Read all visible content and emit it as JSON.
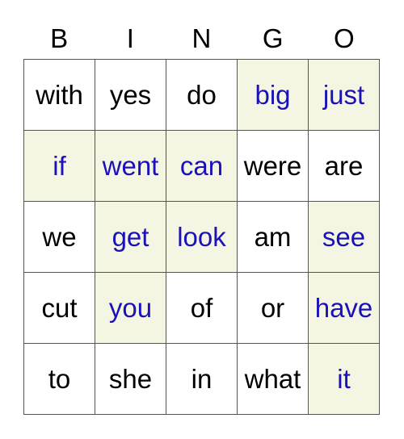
{
  "title_letters": [
    "B",
    "I",
    "N",
    "G",
    "O"
  ],
  "colors": {
    "marked_background": "#f5f5e3",
    "marked_text": "#1a12b8",
    "unmarked_text": "#000000",
    "grid_line": "#555555"
  },
  "rows": [
    [
      {
        "word": "with",
        "marked": false
      },
      {
        "word": "yes",
        "marked": false
      },
      {
        "word": "do",
        "marked": false
      },
      {
        "word": "big",
        "marked": true
      },
      {
        "word": "just",
        "marked": true
      }
    ],
    [
      {
        "word": "if",
        "marked": true
      },
      {
        "word": "went",
        "marked": true
      },
      {
        "word": "can",
        "marked": true
      },
      {
        "word": "were",
        "marked": false
      },
      {
        "word": "are",
        "marked": false
      }
    ],
    [
      {
        "word": "we",
        "marked": false
      },
      {
        "word": "get",
        "marked": true
      },
      {
        "word": "look",
        "marked": true
      },
      {
        "word": "am",
        "marked": false
      },
      {
        "word": "see",
        "marked": true
      }
    ],
    [
      {
        "word": "cut",
        "marked": false
      },
      {
        "word": "you",
        "marked": true
      },
      {
        "word": "of",
        "marked": false
      },
      {
        "word": "or",
        "marked": false
      },
      {
        "word": "have",
        "marked": true
      }
    ],
    [
      {
        "word": "to",
        "marked": false
      },
      {
        "word": "she",
        "marked": false
      },
      {
        "word": "in",
        "marked": false
      },
      {
        "word": "what",
        "marked": false
      },
      {
        "word": "it",
        "marked": true
      }
    ]
  ]
}
